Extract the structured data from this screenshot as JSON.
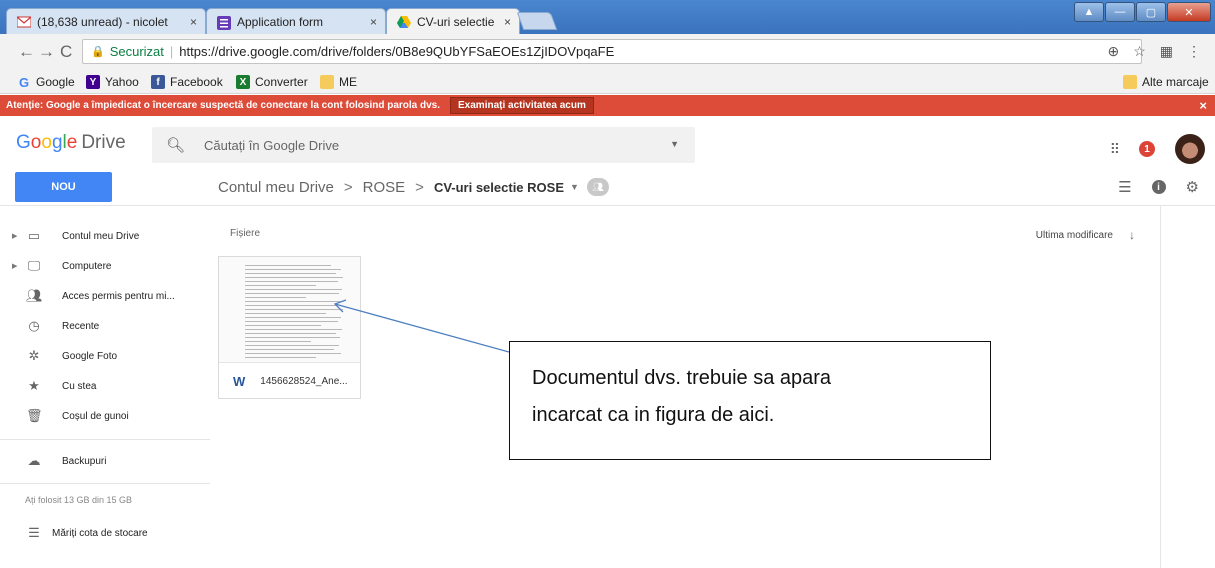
{
  "browser": {
    "tabs": [
      {
        "label": "(18,638 unread) - nicolet",
        "close": "×"
      },
      {
        "label": "Application form",
        "close": "×"
      },
      {
        "label": "CV-uri selectie ROSE – G",
        "close": "×"
      }
    ],
    "secure_label": "Securizat",
    "url": "https://drive.google.com/drive/folders/0B8e9QUbYFSaEOEs1ZjIDOVpqaFE",
    "bookmarks": [
      {
        "label": "Google",
        "icon": "google-icon"
      },
      {
        "label": "Yahoo",
        "icon": "yahoo-icon"
      },
      {
        "label": "Facebook",
        "icon": "facebook-icon"
      },
      {
        "label": "Converter",
        "icon": "converter-icon"
      },
      {
        "label": "ME",
        "icon": "folder-icon"
      }
    ],
    "other_bookmarks": "Alte marcaje"
  },
  "alert": {
    "text": "Atenție: Google a împiedicat o încercare suspectă de conectare la cont folosind parola dvs.",
    "button": "Examinați activitatea acum",
    "close": "×",
    "color": "#dd4b39"
  },
  "drive": {
    "logo": "Google",
    "product": "Drive",
    "search_placeholder": "Căutați în Google Drive",
    "notification_count": "1",
    "new_button": "NOU",
    "breadcrumb": [
      "Contul meu Drive",
      "ROSE",
      "CV-uri selectie ROSE"
    ],
    "breadcrumb_separator": ">",
    "accent": "#4285f4"
  },
  "sidebar": {
    "items": [
      {
        "label": "Contul meu Drive",
        "icon": "drive-icon"
      },
      {
        "label": "Computere",
        "icon": "computer-icon"
      },
      {
        "label": "Acces permis pentru mi...",
        "icon": "shared-with-me-icon"
      },
      {
        "label": "Recente",
        "icon": "clock-icon"
      },
      {
        "label": "Google Foto",
        "icon": "photos-icon"
      },
      {
        "label": "Cu stea",
        "icon": "star-icon"
      },
      {
        "label": "Coșul de gunoi",
        "icon": "trash-icon"
      },
      {
        "label": "Backupuri",
        "icon": "cloud-icon"
      }
    ],
    "storage": "Ați folosit 13 GB din 15 GB",
    "upgrade": "Măriți cota de stocare"
  },
  "main": {
    "files_heading": "Fișiere",
    "sort_label": "Ultima modificare",
    "file": {
      "name": "1456628524_Ane...",
      "type_icon": "W"
    }
  },
  "callout": {
    "line1": "Documentul dvs. trebuie sa apara",
    "line2": "incarcat ca in figura de aici."
  }
}
